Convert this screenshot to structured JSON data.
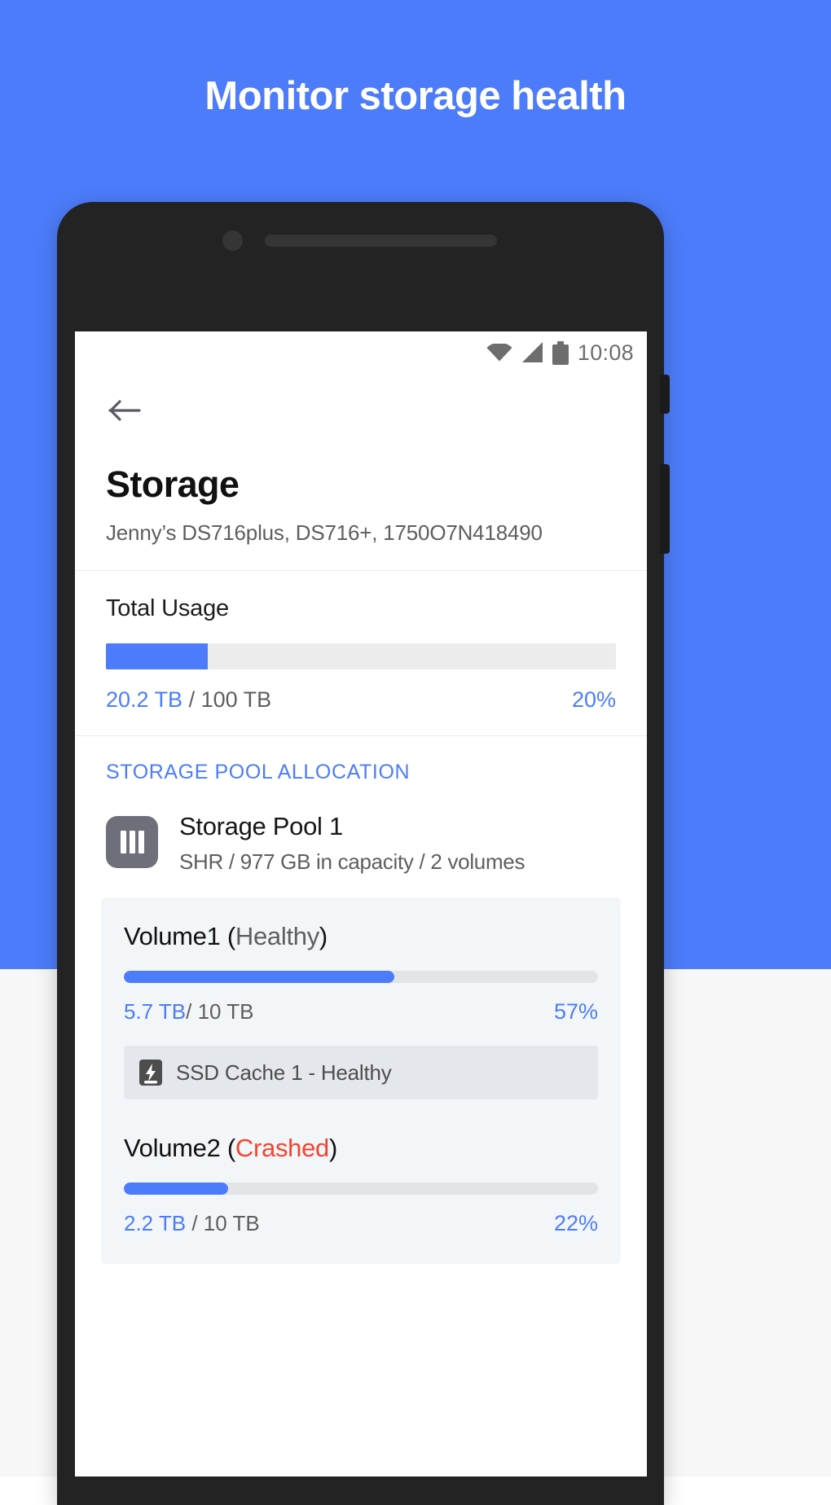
{
  "hero": {
    "headline": "Monitor storage health",
    "bg_color": "#4c7cfa",
    "text_color": "#ffffff"
  },
  "statusbar": {
    "time": "10:08",
    "icons": [
      "wifi-icon",
      "cellular-signal-icon",
      "battery-icon"
    ]
  },
  "header": {
    "back_icon": "back-arrow-icon",
    "title": "Storage",
    "subtitle": "Jenny’s DS716plus, DS716+, 1750O7N418490"
  },
  "total_usage": {
    "label": "Total Usage",
    "used": "20.2 TB",
    "separator": "/ 100 TB",
    "percent_label": "20%",
    "percent_value": 20,
    "fill_color": "#4c7cfa",
    "track_color": "#ececec"
  },
  "pool_section": {
    "label": "STORAGE POOL ALLOCATION",
    "label_color": "#4c7cfa",
    "pool": {
      "icon": "disk-bay-icon",
      "name": "Storage Pool 1",
      "meta": "SHR / 977 GB in capacity / 2 volumes"
    },
    "volumes": [
      {
        "name": "Volume1",
        "status_open": "(",
        "status": "Healthy",
        "status_close": ")",
        "status_color": "#5e5e5e",
        "used": "5.7 TB",
        "separator": "/ 10 TB",
        "percent_label": "57%",
        "percent_value": 57,
        "cache": {
          "icon": "ssd-cache-icon",
          "label": "SSD Cache 1 - Healthy"
        }
      },
      {
        "name": "Volume2",
        "status_open": "(",
        "status": "Crashed",
        "status_close": ")",
        "status_color": "#f4432e",
        "used": "2.2 TB",
        "separator": "/ 10 TB",
        "percent_label": "22%",
        "percent_value": 22,
        "cache": null
      }
    ]
  }
}
